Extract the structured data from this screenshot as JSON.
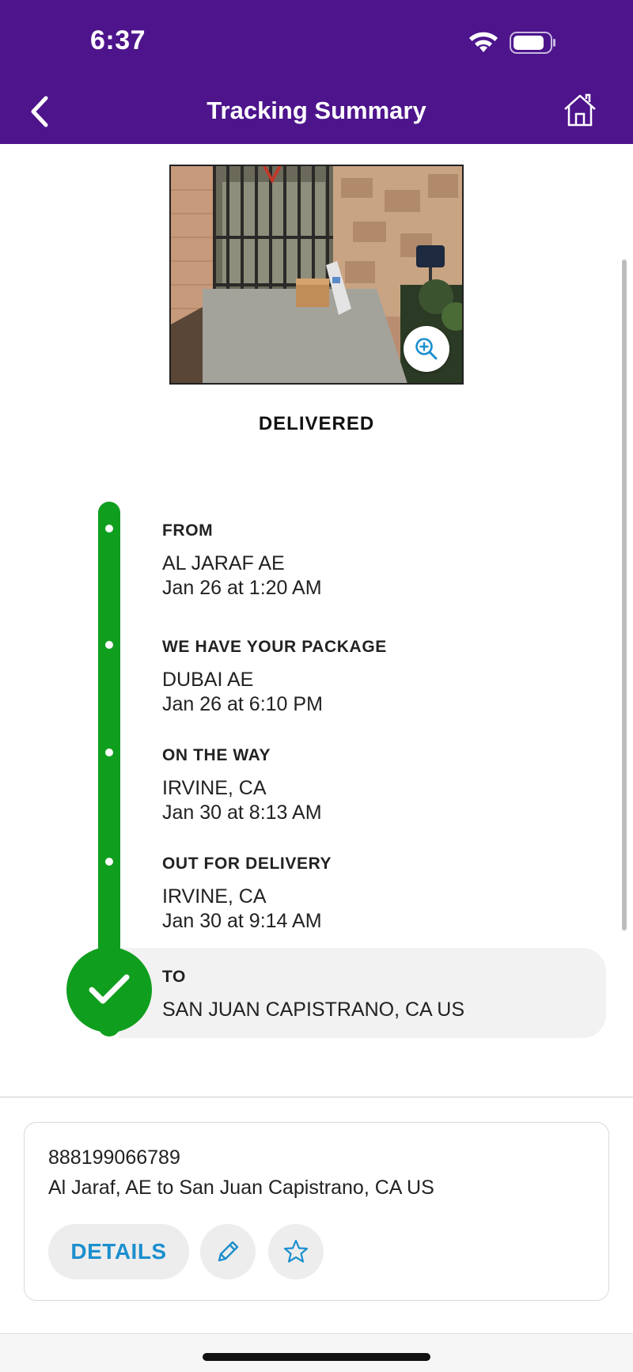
{
  "status_bar": {
    "time": "6:37",
    "icons": [
      "wifi-icon",
      "battery-icon"
    ]
  },
  "header": {
    "title": "Tracking Summary",
    "back_icon": "chevron-left-icon",
    "home_icon": "home-icon",
    "background_color": "#4d148c"
  },
  "delivery_photo": {
    "zoom_icon": "zoom-in-icon"
  },
  "status": "DELIVERED",
  "timeline": {
    "accent_color": "#0f9e1e",
    "events": [
      {
        "label": "FROM",
        "lines": [
          "AL JARAF AE",
          "Jan 26 at 1:20 AM"
        ]
      },
      {
        "label": "WE HAVE YOUR PACKAGE",
        "lines": [
          "DUBAI AE",
          "Jan 26 at 6:10 PM"
        ]
      },
      {
        "label": "ON THE WAY",
        "lines": [
          "IRVINE, CA",
          "Jan 30 at 8:13 AM"
        ]
      },
      {
        "label": "OUT FOR DELIVERY",
        "lines": [
          "IRVINE, CA",
          "Jan 30 at 9:14 AM"
        ]
      },
      {
        "label": "TO",
        "lines": [
          "SAN JUAN CAPISTRANO, CA  US"
        ]
      }
    ]
  },
  "shipment_card": {
    "tracking_number": "888199066789",
    "route": "Al Jaraf, AE to San Juan Capistrano, CA US",
    "details_label": "DETAILS",
    "edit_icon": "pencil-icon",
    "favorite_icon": "star-icon",
    "link_color": "#1b8fce"
  }
}
